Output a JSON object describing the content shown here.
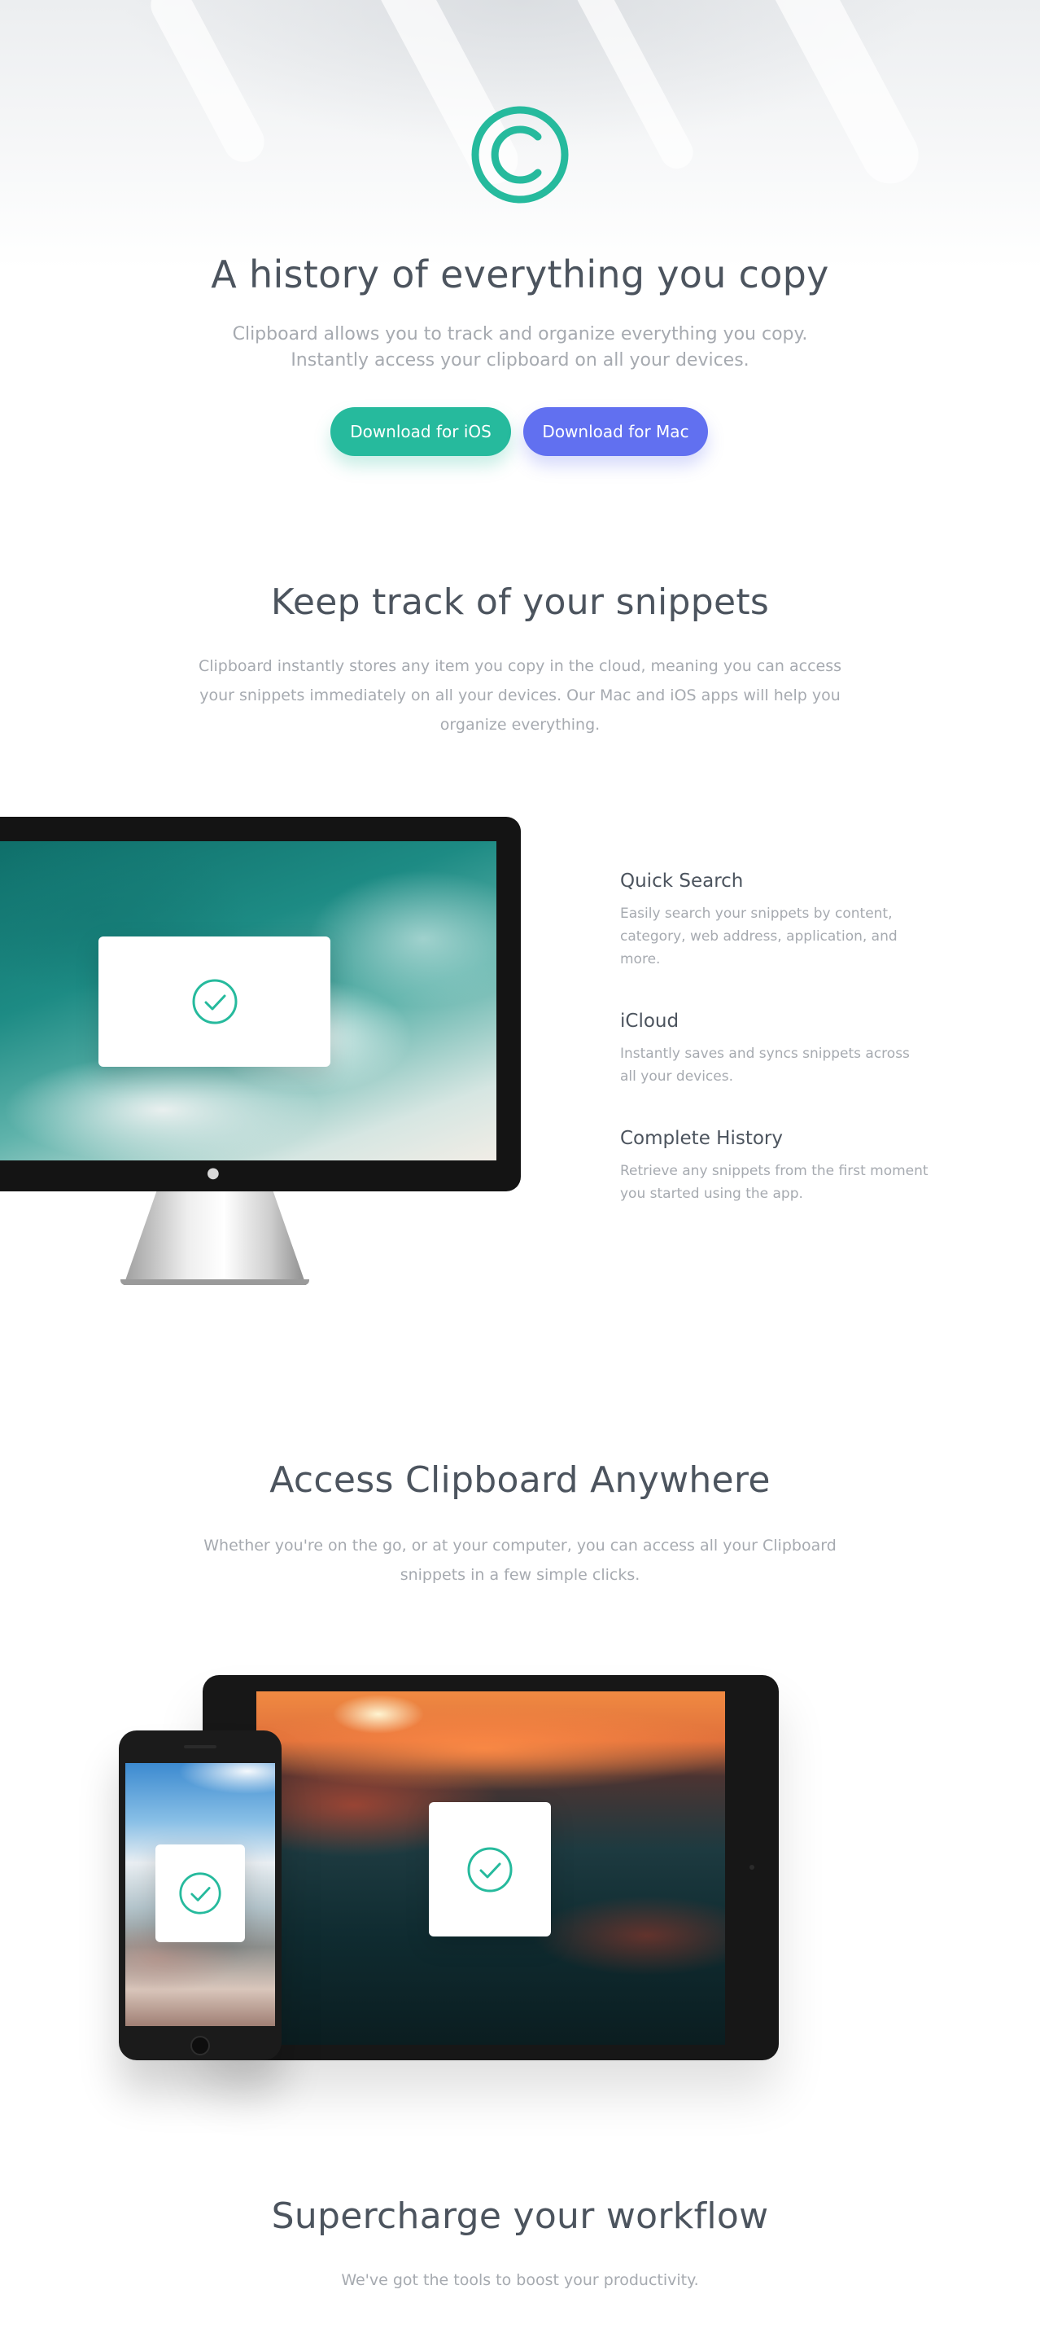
{
  "hero": {
    "logo_icon": "copyright-circle-icon",
    "title": "A history of everything you copy",
    "subtitle_line1": "Clipboard allows you to track and organize everything you copy.",
    "subtitle_line2": "Instantly access your clipboard on all your devices.",
    "buttons": {
      "ios_label": "Download for iOS",
      "mac_label": "Download for Mac"
    }
  },
  "snippets": {
    "title": "Keep track of your snippets",
    "text_line1": "Clipboard instantly stores any item you copy in the cloud, meaning you can access",
    "text_line2": "your snippets immediately on all your devices. Our Mac and iOS apps will help you",
    "text_line3": "organize everything.",
    "features": [
      {
        "title": "Quick Search",
        "text_line1": "Easily search your snippets by content,",
        "text_line2": "category, web address, application, and",
        "text_line3": "more."
      },
      {
        "title": "iCloud",
        "text_line1": "Instantly saves and syncs snippets across",
        "text_line2": "all your devices."
      },
      {
        "title": "Complete History",
        "text_line1": "Retrieve any snippets from the first moment",
        "text_line2": "you started using the app."
      }
    ]
  },
  "access": {
    "title": "Access Clipboard Anywhere",
    "text_line1": "Whether you're on the go, or at your computer, you can access all your Clipboard",
    "text_line2": "snippets in a few simple clicks."
  },
  "workflow": {
    "title": "Supercharge your workflow",
    "text": "We've got the tools to boost your productivity."
  },
  "colors": {
    "accent_green": "#26ba9d",
    "accent_blue": "#6170f0",
    "heading": "#4c545e",
    "body_text": "#a6aab0"
  }
}
